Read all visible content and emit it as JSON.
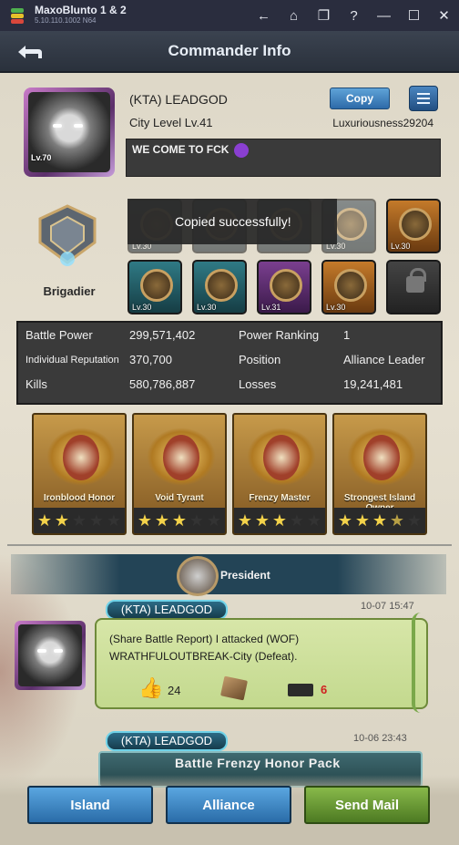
{
  "emulator": {
    "name": "MaxoBlunto 1 & 2",
    "version": "5.10.110.1002 N64",
    "icons": [
      "back-arrow-icon",
      "home-icon",
      "multi-window-icon",
      "help-icon",
      "minimize-icon",
      "maximize-icon",
      "close-icon"
    ],
    "icon_glyphs": [
      "←",
      "⌂",
      "❐",
      "?",
      "—",
      "☐",
      "✕"
    ]
  },
  "header": {
    "title": "Commander Info"
  },
  "profile": {
    "avatar_level": "Lv.70",
    "name": "(KTA) LEADGOD",
    "city_level": "City Level  Lv.41",
    "copy_label": "Copy",
    "luxuriousness": "Luxuriousness29204",
    "motto": "WE COME TO FCK"
  },
  "rank": {
    "title": "Brigadier"
  },
  "toast": "Copied successfully!",
  "badges": [
    {
      "level": "Lv.30",
      "style": "dim"
    },
    {
      "level": "",
      "style": "dim"
    },
    {
      "level": "",
      "style": "dim"
    },
    {
      "level": "Lv.30",
      "style": "dim"
    },
    {
      "level": "Lv.30",
      "style": "orange"
    },
    {
      "level": "Lv.30",
      "style": "teal"
    },
    {
      "level": "Lv.30",
      "style": "teal"
    },
    {
      "level": "Lv.31",
      "style": "purple"
    },
    {
      "level": "Lv.30",
      "style": "orange"
    },
    {
      "level": "",
      "style": "locked"
    }
  ],
  "stats": {
    "battle_power_label": "Battle Power",
    "battle_power": "299,571,402",
    "power_ranking_label": "Power Ranking",
    "power_ranking": "1",
    "reputation_label": "Individual Reputation",
    "reputation": "370,700",
    "position_label": "Position",
    "position": "Alliance Leader",
    "kills_label": "Kills",
    "kills": "580,786,887",
    "losses_label": "Losses",
    "losses": "19,241,481"
  },
  "honors": [
    {
      "name": "Ironblood Honor",
      "stars": 2
    },
    {
      "name": "Void Tyrant",
      "stars": 3
    },
    {
      "name": "Frenzy Master",
      "stars": 3
    },
    {
      "name": "Strongest Island Owner",
      "stars": 3.5
    }
  ],
  "president_label": "President",
  "messages": [
    {
      "author": "(KTA) LEADGOD",
      "time": "10-07 15:47",
      "text": "(Share Battle Report) I attacked  (WOF) WRATHFULOUTBREAK-City (Defeat).",
      "likes": "24",
      "comments": "6"
    },
    {
      "author": "(KTA) LEADGOD",
      "time": "10-06 23:43",
      "pack_title": "Battle Frenzy Honor Pack"
    }
  ],
  "bottom": {
    "island": "Island",
    "alliance": "Alliance",
    "send_mail": "Send Mail"
  }
}
